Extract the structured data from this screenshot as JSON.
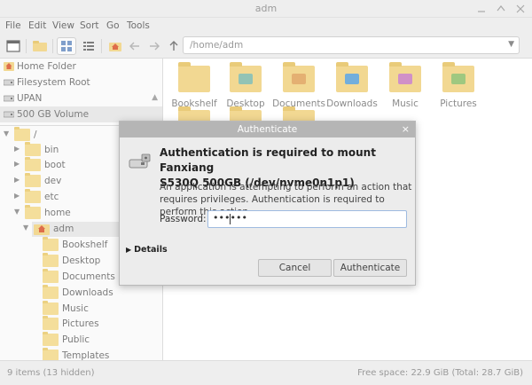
{
  "window": {
    "title": "adm"
  },
  "menu": [
    "File",
    "Edit",
    "View",
    "Sort",
    "Go",
    "Tools"
  ],
  "location": {
    "path": "/home/adm"
  },
  "places": [
    {
      "label": "Home Folder",
      "icon": "home-folder-icon"
    },
    {
      "label": "Filesystem Root",
      "icon": "drive-icon"
    },
    {
      "label": "UPAN",
      "icon": "drive-icon",
      "ejectable": true
    },
    {
      "label": "500 GB Volume",
      "icon": "drive-icon",
      "selected": true
    }
  ],
  "tree": [
    {
      "label": "/",
      "depth": 0,
      "expanded": true
    },
    {
      "label": "bin",
      "depth": 1
    },
    {
      "label": "boot",
      "depth": 1
    },
    {
      "label": "dev",
      "depth": 1
    },
    {
      "label": "etc",
      "depth": 1
    },
    {
      "label": "home",
      "depth": 1,
      "expanded": true
    },
    {
      "label": "adm",
      "depth": 2,
      "expanded": true,
      "selected": true
    },
    {
      "label": "Bookshelf",
      "depth": 3
    },
    {
      "label": "Desktop",
      "depth": 3
    },
    {
      "label": "Documents",
      "depth": 3
    },
    {
      "label": "Downloads",
      "depth": 3
    },
    {
      "label": "Music",
      "depth": 3
    },
    {
      "label": "Pictures",
      "depth": 3
    },
    {
      "label": "Public",
      "depth": 3
    },
    {
      "label": "Templates",
      "depth": 3
    }
  ],
  "files": [
    {
      "label": "Bookshelf"
    },
    {
      "label": "Desktop"
    },
    {
      "label": "Documents"
    },
    {
      "label": "Downloads"
    },
    {
      "label": "Music"
    },
    {
      "label": "Pictures"
    }
  ],
  "status": {
    "items": "9 items (13 hidden)",
    "free": "Free space: 22.9 GiB (Total: 28.7 GiB)"
  },
  "dialog": {
    "title": "Authenticate",
    "heading_line1": "Authentication is required to mount Fanxiang",
    "heading_line2": "S530Q 500GB (/dev/nvme0n1p1)",
    "body": "An application is attempting to perform an action that requires privileges. Authentication is required to perform this action.",
    "password_label": "Password:",
    "password_value": "••••••",
    "details_label": "Details",
    "cancel_label": "Cancel",
    "authenticate_label": "Authenticate"
  },
  "colors": {
    "folder": "#f0d27f",
    "dialog_title": "#b5b5b5",
    "focus_border": "#9fbbe0"
  }
}
